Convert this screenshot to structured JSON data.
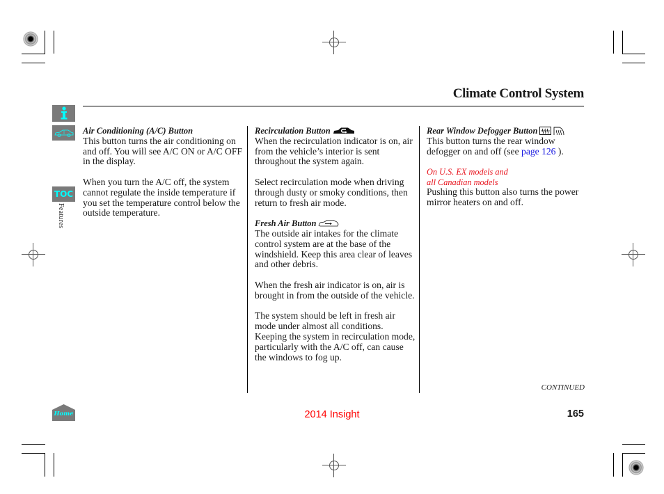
{
  "header": {
    "title": "Climate Control System"
  },
  "side_nav": {
    "info_icon": "info-icon",
    "car_icon": "car-index-icon",
    "toc_label": "TOC",
    "section_label": "Features",
    "home_label": "Home"
  },
  "columns": [
    {
      "sections": [
        {
          "heading": "Air Conditioning (A/C) Button",
          "paragraphs": [
            "This button turns the air conditioning on and off. You will see A/C ON or A/C OFF in the display.",
            "When you turn the A/C off, the system cannot regulate the inside temperature if you set the temperature control below the outside temperature."
          ]
        }
      ]
    },
    {
      "sections": [
        {
          "heading": "Recirculation Button",
          "icon": "recirculation-icon",
          "paragraphs": [
            "When the recirculation indicator is on, air from the vehicle’s interior is sent throughout the system again.",
            "Select recirculation mode when driving through dusty or smoky conditions, then return to fresh air mode."
          ]
        },
        {
          "heading": "Fresh Air Button",
          "icon": "fresh-air-icon",
          "paragraphs": [
            "The outside air intakes for the climate control system are at the base of the windshield. Keep this area clear of leaves and other debris.",
            "When the fresh air indicator is on, air is brought in from the outside of the vehicle.",
            "The system should be left in fresh air mode under almost all conditions. Keeping the system in recirculation mode, particularly with the A/C off, can cause the windows to fog up."
          ]
        }
      ]
    },
    {
      "sections": [
        {
          "heading": "Rear Window Defogger Button",
          "icons": [
            "rear-defogger-icon",
            "mirror-heater-icon"
          ],
          "paragraph_prefix": "This button turns the rear window defogger on and off (see ",
          "link_text": "page 126",
          "paragraph_suffix": " ).",
          "note": [
            "On U.S. EX models and",
            "all Canadian models"
          ],
          "note_paragraph": "Pushing this button also turns the power mirror heaters on and off."
        }
      ]
    }
  ],
  "footer": {
    "continued": "CONTINUED",
    "model": "2014 Insight",
    "page_number": "165"
  },
  "colors": {
    "accent_cyan": "#00ffff",
    "tab_gray": "#7a7a7a",
    "note_red": "#e8141e",
    "link_blue": "#1414e0",
    "footer_red": "#ff0000"
  }
}
